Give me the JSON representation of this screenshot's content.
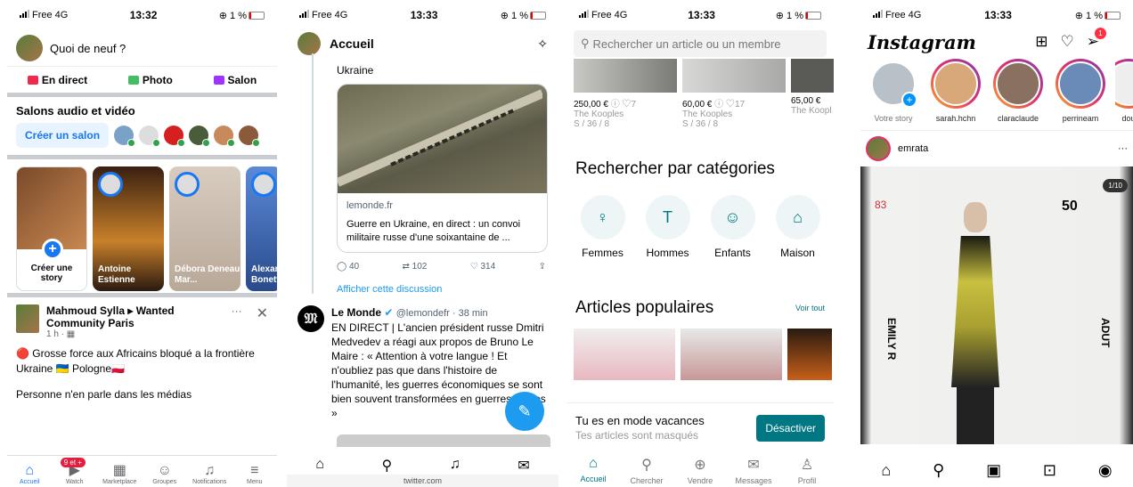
{
  "facebook": {
    "status": {
      "carrier": "Free 4G",
      "time": "13:32",
      "battery": "1 %"
    },
    "composer_placeholder": "Quoi de neuf ?",
    "actions": [
      {
        "label": "En direct",
        "color": "#f02849"
      },
      {
        "label": "Photo",
        "color": "#45bd62"
      },
      {
        "label": "Salon",
        "color": "#a033ff"
      }
    ],
    "salons_title": "Salons audio et vidéo",
    "create_salon": "Créer un salon",
    "stories": [
      {
        "name": "Créer une story"
      },
      {
        "name": "Antoine Estienne"
      },
      {
        "name": "Débora Deneau Mar..."
      },
      {
        "name": "Alexan Bonett"
      }
    ],
    "post": {
      "author": "Mahmoud Sylla",
      "group": "Wanted Community Paris",
      "meta": "1 h · ",
      "text_line1": "🔴 Grosse force aux Africains bloqué a la frontière",
      "text_line2": "Ukraine 🇺🇦 Pologne🇵🇱",
      "text_line3": "Personne n'en parle dans les médias"
    },
    "tabs": [
      {
        "label": "Accueil",
        "icon": "home-icon",
        "glyph": "⌂"
      },
      {
        "label": "Watch",
        "icon": "watch-icon",
        "glyph": "▶",
        "badge": "9 et +"
      },
      {
        "label": "Marketplace",
        "icon": "marketplace-icon",
        "glyph": "▦"
      },
      {
        "label": "Groupes",
        "icon": "groups-icon",
        "glyph": "☺"
      },
      {
        "label": "Notifications",
        "icon": "bell-icon",
        "glyph": "♫"
      },
      {
        "label": "Menu",
        "icon": "menu-icon",
        "glyph": "≡"
      }
    ]
  },
  "twitter": {
    "status": {
      "carrier": "Free 4G",
      "time": "13:33",
      "battery": "1 %"
    },
    "title": "Accueil",
    "context_text": "Ukraine",
    "card": {
      "domain": "lemonde.fr",
      "title": "Guerre en Ukraine, en direct : un convoi militaire russe d'une soixantaine de ..."
    },
    "counts": {
      "replies": "40",
      "retweets": "102",
      "likes": "314"
    },
    "show_thread": "Afficher cette discussion",
    "tweet": {
      "name": "Le Monde",
      "handle": "@lemondefr · 38 min",
      "text": "EN DIRECT | L'ancien président russe Dmitri Medvedev a réagi aux propos de Bruno Le Maire : « Attention à votre langue ! Et n'oubliez pas que dans l'histoire de l'humanité, les guerres économiques se sont bien souvent transformées en guerres réelles »"
    },
    "url_bar": "twitter.com"
  },
  "vinted": {
    "status": {
      "carrier": "Free 4G",
      "time": "13:33",
      "battery": "1 %"
    },
    "search_placeholder": "Rechercher un article ou un membre",
    "products": [
      {
        "price": "250,00 €",
        "likes": "7",
        "brand": "The Kooples",
        "size": "S / 36 / 8"
      },
      {
        "price": "60,00 €",
        "likes": "17",
        "brand": "The Kooples",
        "size": "S / 36 / 8"
      },
      {
        "price": "65,00 €",
        "likes": "",
        "brand": "The Koopl",
        "size": ""
      }
    ],
    "categories_title": "Rechercher par catégories",
    "categories": [
      {
        "label": "Femmes",
        "glyph": "♀"
      },
      {
        "label": "Hommes",
        "glyph": "T"
      },
      {
        "label": "Enfants",
        "glyph": "☺"
      },
      {
        "label": "Maison",
        "glyph": "⌂"
      }
    ],
    "popular_title": "Articles populaires",
    "see_all": "Voir tout",
    "vacation": {
      "title": "Tu es en mode vacances",
      "subtitle": "Tes articles sont masqués",
      "button": "Désactiver"
    },
    "tabs": [
      {
        "label": "Accueil",
        "glyph": "⌂"
      },
      {
        "label": "Chercher",
        "glyph": "⚲"
      },
      {
        "label": "Vendre",
        "glyph": "⊕"
      },
      {
        "label": "Messages",
        "glyph": "✉"
      },
      {
        "label": "Profil",
        "glyph": "♙"
      }
    ]
  },
  "instagram": {
    "status": {
      "carrier": "Free 4G",
      "time": "13:33",
      "battery": "1 %"
    },
    "logo": "Instagram",
    "dm_badge": "1",
    "stories": [
      {
        "name": "Votre story"
      },
      {
        "name": "sarah.hchn"
      },
      {
        "name": "claraclaude"
      },
      {
        "name": "perrineam"
      },
      {
        "name": "dou"
      }
    ],
    "post_user": "emrata",
    "post_counter": "1/10",
    "photo_texts": {
      "left_top": "83",
      "right_top": "50",
      "left_side": "EMILY R",
      "right_side": "ADUT"
    }
  }
}
